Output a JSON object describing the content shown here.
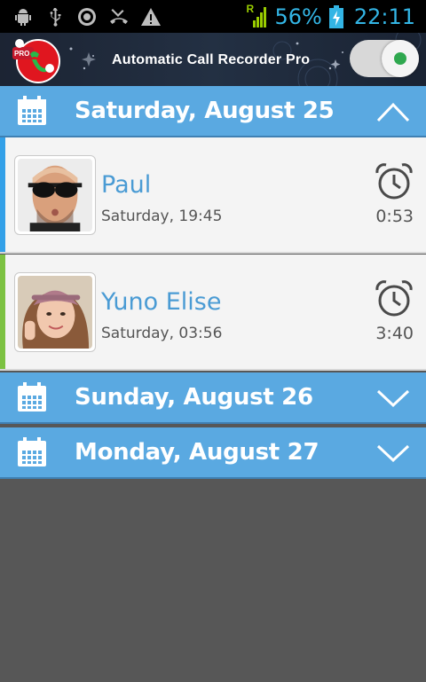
{
  "status_bar": {
    "icons": [
      "android-debug-icon",
      "usb-icon",
      "target-icon",
      "missed-call-icon",
      "warning-icon"
    ],
    "roaming_indicator": "R",
    "battery_percent": "56%",
    "time": "22:11",
    "accent_color": "#33b5e5"
  },
  "app_bar": {
    "logo_badge": "PRO",
    "title": "Automatic Call Recorder Pro",
    "recording_enabled": true
  },
  "days": [
    {
      "title": "Saturday, August 25",
      "expanded": true,
      "chevron": "chevron-up-icon",
      "calls": [
        {
          "name": "Paul",
          "time": "Saturday, 19:45",
          "duration": "0:53",
          "stripe_color": "#33a0e8"
        },
        {
          "name": "Yuno Elise",
          "time": "Saturday, 03:56",
          "duration": "3:40",
          "stripe_color": "#7cc242"
        }
      ]
    },
    {
      "title": "Sunday, August 26",
      "expanded": false,
      "chevron": "chevron-down-icon",
      "calls": []
    },
    {
      "title": "Monday, August 27",
      "expanded": false,
      "chevron": "chevron-down-icon",
      "calls": []
    }
  ],
  "colors": {
    "header_blue": "#5aa9e1",
    "name_blue": "#4a9bd4",
    "empty_background": "#575757"
  }
}
